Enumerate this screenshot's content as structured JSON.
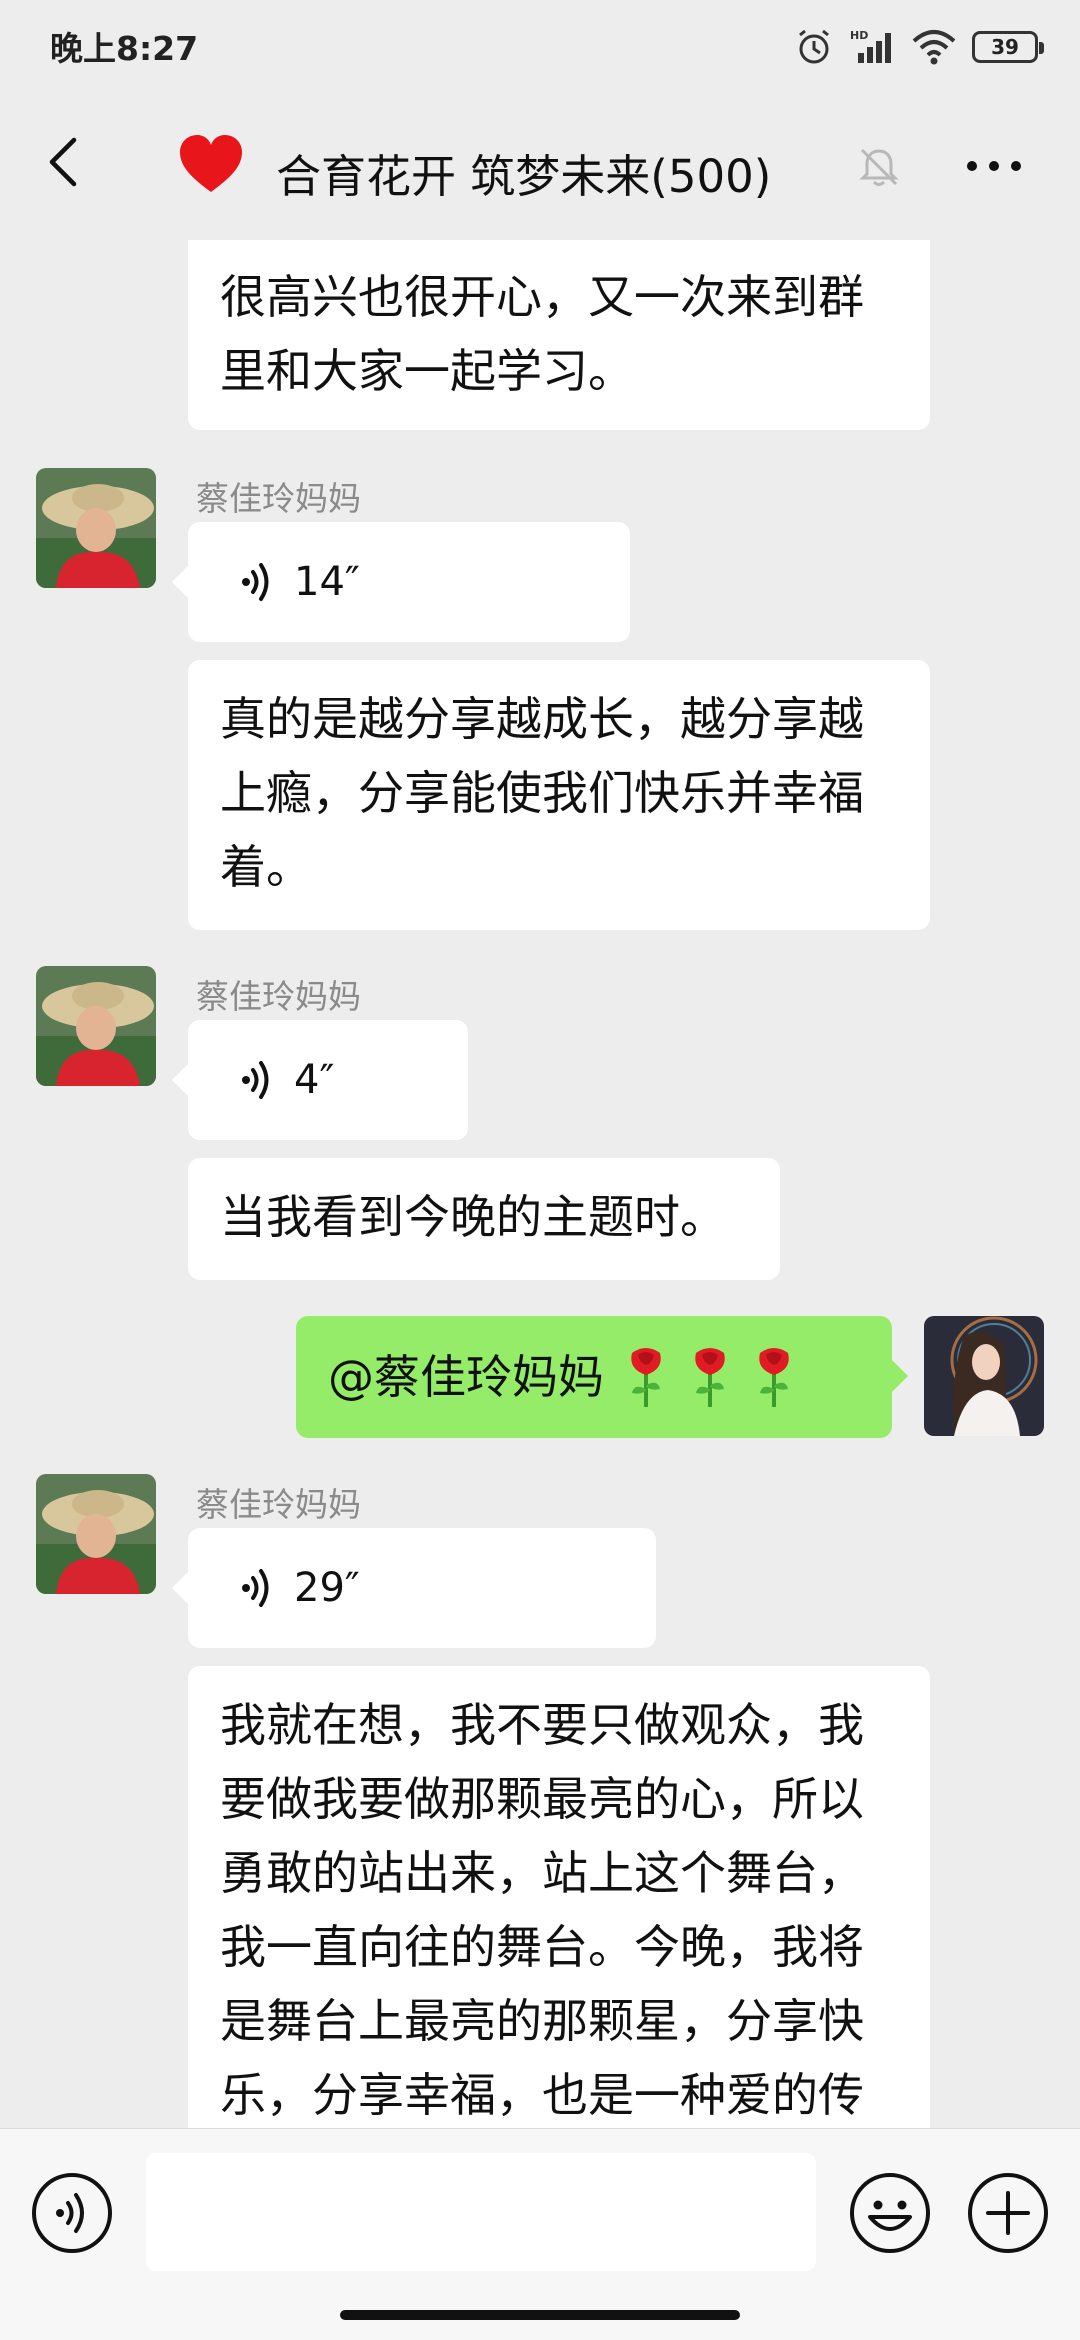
{
  "status_bar": {
    "time": "晚上8:27",
    "battery": "39",
    "icons": [
      "alarm-icon",
      "hd-signal-icon",
      "wifi-icon",
      "battery-icon"
    ]
  },
  "header": {
    "title": "合育花开 筑梦未来(500)",
    "icons": [
      "back-arrow-icon",
      "red-heart-icon",
      "mute-bell-icon",
      "more-icon"
    ]
  },
  "messages": [
    {
      "type": "text",
      "side": "left",
      "lines": [
        "很高兴也很开心，又一次来到群",
        "里和大家一起学习。"
      ]
    },
    {
      "type": "voice",
      "side": "left",
      "sender": "蔡佳玲妈妈",
      "duration": "14″"
    },
    {
      "type": "text",
      "side": "left",
      "lines": [
        "真的是越分享越成长，越分享越",
        "上瘾，分享能使我们快乐并幸福",
        "着。"
      ]
    },
    {
      "type": "voice",
      "side": "left",
      "sender": "蔡佳玲妈妈",
      "duration": "4″"
    },
    {
      "type": "text",
      "side": "left",
      "lines": [
        "当我看到今晚的主题时。"
      ]
    },
    {
      "type": "text",
      "side": "right",
      "lines": [
        "@蔡佳玲妈妈"
      ],
      "emoji": [
        "rose-emoji",
        "rose-emoji",
        "rose-emoji"
      ]
    },
    {
      "type": "voice",
      "side": "left",
      "sender": "蔡佳玲妈妈",
      "duration": "29″"
    },
    {
      "type": "text",
      "side": "left",
      "lines": [
        "我就在想，我不要只做观众，我",
        "要做我要做那颗最亮的心，所以",
        "勇敢的站出来，站上这个舞台，",
        "我一直向往的舞台。今晚，我将",
        "是舞台上最亮的那颗星，分享快",
        "乐，分享幸福，也是一种爱的传"
      ]
    }
  ],
  "input_bar": {
    "value": "",
    "icons": [
      "voice-input-icon",
      "emoji-icon",
      "plus-icon"
    ]
  },
  "colors": {
    "background": "#ededed",
    "self_bubble": "#95ec69",
    "other_bubble": "#ffffff",
    "heart": "#e8161b"
  }
}
